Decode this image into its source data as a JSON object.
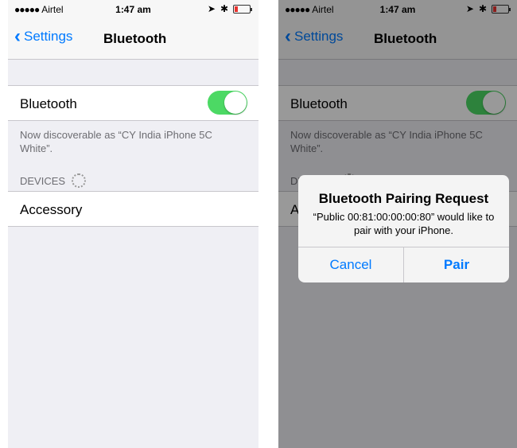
{
  "status_bar": {
    "carrier": "Airtel",
    "time": "1:47 am",
    "signal_dots": "●●●●●"
  },
  "nav": {
    "back_label": "Settings",
    "title": "Bluetooth"
  },
  "bluetooth_row": {
    "label": "Bluetooth",
    "enabled": true,
    "toggle_color": "#4cd964"
  },
  "discoverable_text": "Now discoverable as “CY India iPhone 5C White”.",
  "devices_header": "DEVICES",
  "devices": [
    {
      "name": "Accessory"
    }
  ],
  "alert": {
    "title": "Bluetooth Pairing Request",
    "message": "“Public 00:81:00:00:00:80” would like to pair with your iPhone.",
    "cancel_label": "Cancel",
    "pair_label": "Pair"
  },
  "colors": {
    "accent": "#007aff",
    "background": "#efeff4"
  }
}
